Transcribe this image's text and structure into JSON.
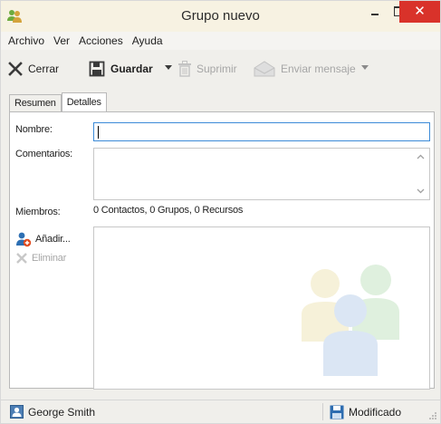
{
  "window": {
    "title": "Grupo nuevo",
    "close_glyph": "✕"
  },
  "menu": {
    "items": [
      {
        "label": "Archivo"
      },
      {
        "label": "Ver"
      },
      {
        "label": "Acciones"
      },
      {
        "label": "Ayuda"
      }
    ]
  },
  "toolbar": {
    "close_label": "Cerrar",
    "save_label": "Guardar",
    "delete_label": "Suprimir",
    "send_label": "Enviar mensaje"
  },
  "tabs": [
    {
      "label": "Resumen",
      "active": false
    },
    {
      "label": "Detalles",
      "active": true
    }
  ],
  "form": {
    "name_label": "Nombre:",
    "name_value": "",
    "comments_label": "Comentarios:",
    "comments_value": "",
    "members_label": "Miembros:",
    "members_summary": "0 Contactos, 0 Grupos, 0 Recursos",
    "add_label": "Añadir...",
    "remove_label": "Eliminar"
  },
  "status": {
    "user": "George Smith",
    "state": "Modificado"
  },
  "colors": {
    "titlebar": "#f7f2e2",
    "close_button": "#d9322a",
    "input_focus": "#3c8bd8",
    "disabled_text": "#a6a6a6"
  },
  "icons": {
    "app": "group-app-icon",
    "close_tool": "close-x-icon",
    "save_tool": "floppy-disk-icon",
    "delete_tool": "trash-icon",
    "send_tool": "envelope-icon",
    "add_member": "add-user-icon",
    "remove_member": "remove-x-icon",
    "watermark": "people-group-icon",
    "status_user": "user-card-icon",
    "status_state": "floppy-disk-icon"
  }
}
